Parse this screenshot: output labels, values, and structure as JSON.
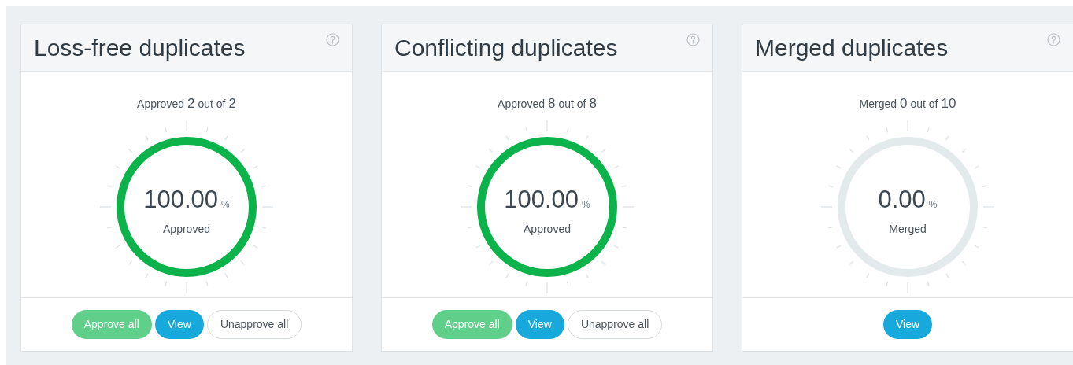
{
  "cards": [
    {
      "title": "Loss-free duplicates",
      "summary": {
        "label": "Approved",
        "count": "2",
        "middle": "out of",
        "total": "2"
      },
      "gauge": {
        "complete": true,
        "value": "100.00",
        "unit": "%",
        "caption": "Approved"
      },
      "buttons": [
        {
          "kind": "approve",
          "label": "Approve all"
        },
        {
          "kind": "view",
          "label": "View"
        },
        {
          "kind": "unapprove",
          "label": "Unapprove all"
        }
      ]
    },
    {
      "title": "Conflicting duplicates",
      "summary": {
        "label": "Approved",
        "count": "8",
        "middle": "out of",
        "total": "8"
      },
      "gauge": {
        "complete": true,
        "value": "100.00",
        "unit": "%",
        "caption": "Approved"
      },
      "buttons": [
        {
          "kind": "approve",
          "label": "Approve all"
        },
        {
          "kind": "view",
          "label": "View"
        },
        {
          "kind": "unapprove",
          "label": "Unapprove all"
        }
      ]
    },
    {
      "title": "Merged duplicates",
      "summary": {
        "label": "Merged",
        "count": "0",
        "middle": "out of",
        "total": "10"
      },
      "gauge": {
        "complete": false,
        "value": "0.00",
        "unit": "%",
        "caption": "Merged"
      },
      "buttons": [
        {
          "kind": "view",
          "label": "View"
        }
      ]
    }
  ]
}
